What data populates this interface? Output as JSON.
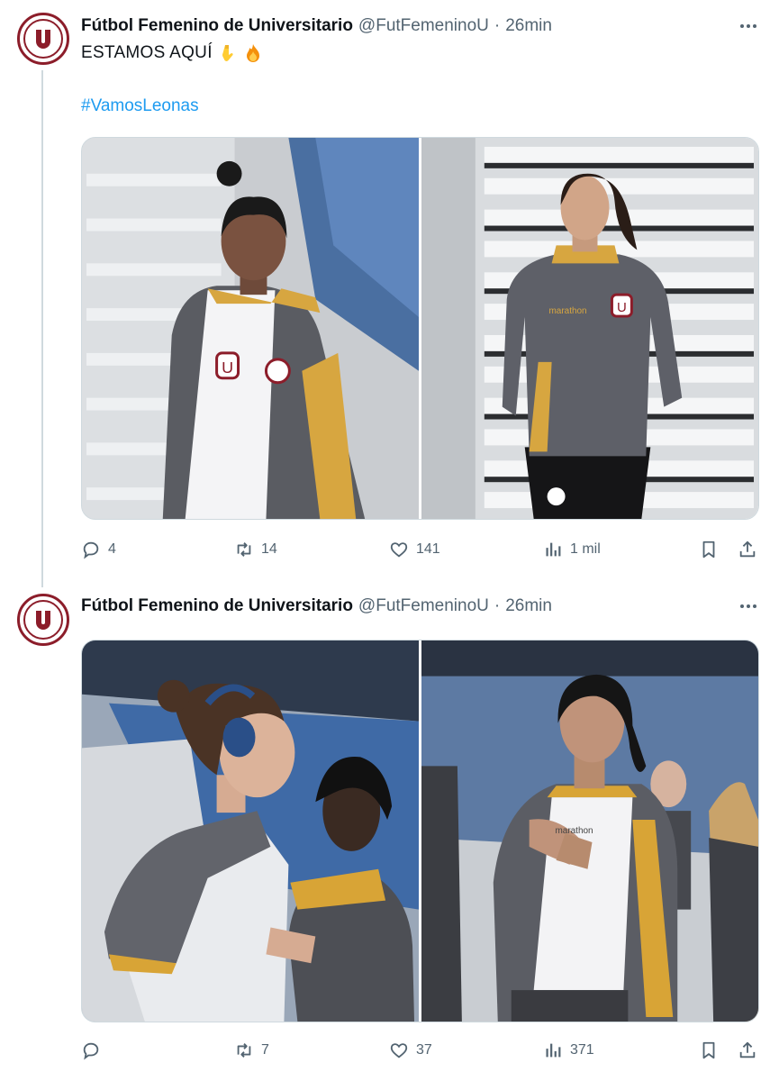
{
  "tweets": [
    {
      "author_name": "Fútbol Femenino de Universitario",
      "handle": "@FutFemeninoU",
      "separator": "·",
      "time": "26min",
      "text": "ESTAMOS AQUÍ",
      "emojis": [
        "backhand-index-pointing-down",
        "fire"
      ],
      "hashtag": "#VamosLeonas",
      "photos": [
        "player-hoodie-looking-right",
        "player-walking-stadium"
      ],
      "stats": {
        "replies": "4",
        "retweets": "14",
        "likes": "141",
        "views": "1 mil"
      }
    },
    {
      "author_name": "Fútbol Femenino de Universitario",
      "handle": "@FutFemeninoU",
      "separator": "·",
      "time": "26min",
      "photos": [
        "player-with-headphones",
        "player-clapping"
      ],
      "stats": {
        "replies": "",
        "retweets": "7",
        "likes": "37",
        "views": "371"
      }
    }
  ],
  "icons": [
    "reply-icon",
    "retweet-icon",
    "like-icon",
    "views-icon",
    "bookmark-icon",
    "share-icon",
    "more-icon"
  ],
  "colors": {
    "link": "#1d9bf0",
    "muted": "#536471",
    "brand": "#8c1d2a"
  }
}
